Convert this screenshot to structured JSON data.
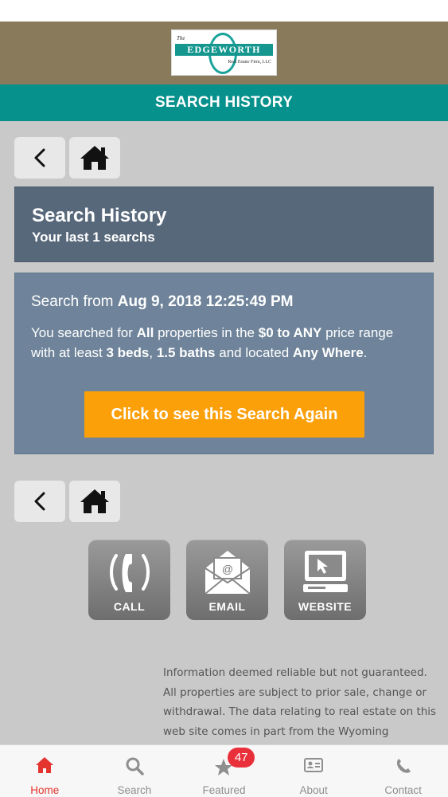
{
  "brand": {
    "logo_the": "The",
    "logo_name": "EDGEWORTH",
    "logo_sub": "Real Estate Firm, LLC"
  },
  "header": {
    "title": "SEARCH HISTORY"
  },
  "history": {
    "title": "Search History",
    "subtitle": "Your last 1 searchs"
  },
  "search": {
    "from_prefix": "Search from ",
    "date": "Aug 9, 2018 12:25:49 PM",
    "desc_1": "You searched for ",
    "type": "All",
    "desc_2": " properties in the ",
    "price": "$0 to ANY",
    "desc_3": " price range with at least ",
    "beds": "3 beds",
    "desc_4": ", ",
    "baths": "1.5 baths",
    "desc_5": " and located ",
    "location": "Any Where",
    "desc_6": ".",
    "again_button": "Click to see this Search Again"
  },
  "contact_buttons": {
    "call": "CALL",
    "email": "EMAIL",
    "website": "WEBSITE"
  },
  "disclaimer": "Information deemed reliable but not guaranteed. All properties are subject to prior sale, change or withdrawal. The data relating to real estate on this web site comes in part from the Wyoming",
  "tabs": {
    "home": "Home",
    "search": "Search",
    "featured": "Featured",
    "featured_badge": "47",
    "about": "About",
    "contact": "Contact"
  },
  "colors": {
    "brand_bar": "#8a7a5c",
    "title_bar": "#06918c",
    "header_card": "#57687a",
    "search_card": "#6f849a",
    "accent_button": "#fca00a",
    "active_tab": "#e3342f"
  },
  "icons": {
    "back": "chevron-left-icon",
    "home": "home-icon",
    "call": "phone-icon",
    "email": "envelope-icon",
    "website": "computer-icon",
    "tab_search": "search-icon",
    "tab_featured": "star-icon",
    "tab_about": "id-card-icon",
    "tab_contact": "phone-handset-icon"
  }
}
